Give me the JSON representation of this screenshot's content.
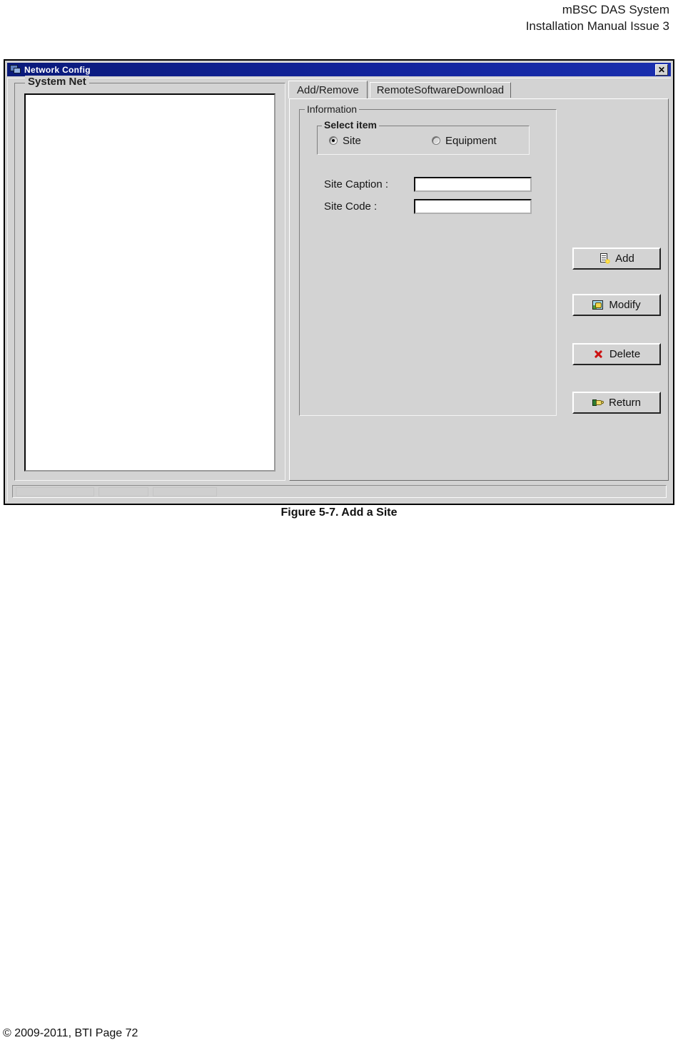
{
  "page_header": {
    "line1": "mBSC DAS System",
    "line2": "Installation Manual Issue 3"
  },
  "window": {
    "title": "Network Config",
    "icon": "network-computers-icon",
    "close_label": "✕"
  },
  "left_panel": {
    "group_label": "System Net",
    "tree_items": []
  },
  "tabs": [
    {
      "label": "Add/Remove",
      "active": true
    },
    {
      "label": "RemoteSoftwareDownload",
      "active": false
    }
  ],
  "information": {
    "group_label": "Information",
    "select_item": {
      "group_label": "Select item",
      "options": [
        {
          "label": "Site",
          "selected": true
        },
        {
          "label": "Equipment",
          "selected": false
        }
      ]
    },
    "fields": [
      {
        "label": "Site Caption :",
        "value": "",
        "placeholder": ""
      },
      {
        "label": "Site Code :",
        "value": "",
        "placeholder": ""
      }
    ]
  },
  "buttons": [
    {
      "label": "Add",
      "icon": "new-document-icon"
    },
    {
      "label": "Modify",
      "icon": "edit-pad-icon"
    },
    {
      "label": "Delete",
      "icon": "red-x-icon"
    },
    {
      "label": "Return",
      "icon": "pointing-hand-icon"
    }
  ],
  "status_bar": {
    "text": ""
  },
  "figure_caption": "Figure 5-7. Add a Site",
  "page_footer": "© 2009-2011, BTI Page 72",
  "colors": {
    "titlebar_start": "#0a1a7a",
    "titlebar_end": "#1a2fae",
    "window_face": "#d3d3d3",
    "field_bg": "#ffffff",
    "delete_icon": "#cc1111"
  }
}
